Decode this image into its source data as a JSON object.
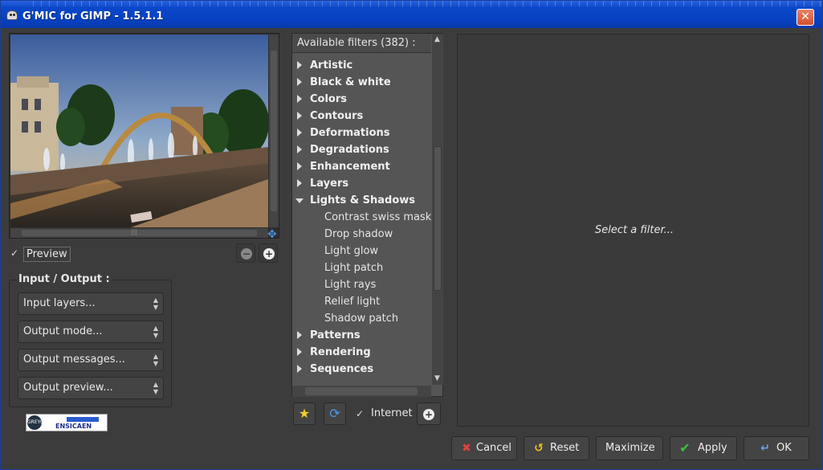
{
  "window": {
    "title": "G'MIC for GIMP - 1.5.1.1",
    "close_glyph": "✕"
  },
  "preview": {
    "checked": true,
    "label": "Preview",
    "zoom_out_glyph": "−",
    "zoom_in_glyph": "+"
  },
  "io": {
    "title": "Input / Output :",
    "combos": [
      {
        "label": "Input layers..."
      },
      {
        "label": "Output mode..."
      },
      {
        "label": "Output messages..."
      },
      {
        "label": "Output preview..."
      }
    ]
  },
  "logo": {
    "text": "ENSICAEN",
    "badge": "GREYC"
  },
  "filters": {
    "header": "Available filters (382) :",
    "items": [
      {
        "label": "Artistic",
        "type": "cat",
        "open": false
      },
      {
        "label": "Black & white",
        "type": "cat",
        "open": false
      },
      {
        "label": "Colors",
        "type": "cat",
        "open": false
      },
      {
        "label": "Contours",
        "type": "cat",
        "open": false
      },
      {
        "label": "Deformations",
        "type": "cat",
        "open": false
      },
      {
        "label": "Degradations",
        "type": "cat",
        "open": false
      },
      {
        "label": "Enhancement",
        "type": "cat",
        "open": false
      },
      {
        "label": "Layers",
        "type": "cat",
        "open": false
      },
      {
        "label": "Lights & Shadows",
        "type": "cat",
        "open": true
      },
      {
        "label": "Contrast swiss mask",
        "type": "sub"
      },
      {
        "label": "Drop shadow",
        "type": "sub"
      },
      {
        "label": "Light glow",
        "type": "sub"
      },
      {
        "label": "Light patch",
        "type": "sub"
      },
      {
        "label": "Light rays",
        "type": "sub"
      },
      {
        "label": "Relief light",
        "type": "sub"
      },
      {
        "label": "Shadow patch",
        "type": "sub"
      },
      {
        "label": "Patterns",
        "type": "cat",
        "open": false
      },
      {
        "label": "Rendering",
        "type": "cat",
        "open": false
      },
      {
        "label": "Sequences",
        "type": "cat",
        "open": false
      }
    ]
  },
  "toolbar": {
    "internet_label": "Internet",
    "internet_checked": true
  },
  "right_panel": {
    "message": "Select a filter..."
  },
  "buttons": {
    "cancel": {
      "label": "Cancel",
      "icon": "cancel-icon",
      "color": "#e04040"
    },
    "reset": {
      "label": "Reset",
      "icon": "reset-icon",
      "color": "#f0c020"
    },
    "maximize": {
      "label": "Maximize"
    },
    "apply": {
      "label": "Apply",
      "icon": "check-icon",
      "color": "#40c040"
    },
    "ok": {
      "label": "OK",
      "icon": "enter-icon",
      "color": "#6aa0e8"
    }
  }
}
